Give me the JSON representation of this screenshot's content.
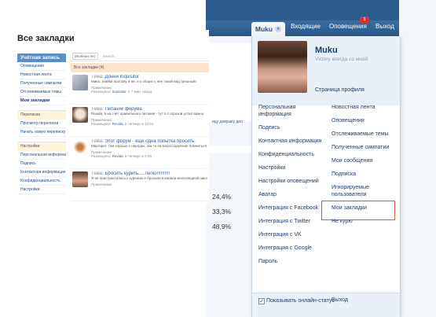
{
  "left_panel": {
    "title": "Все закладки",
    "sidebar_header": "Учётная запись",
    "sidebar_items": [
      "Оповещения",
      "Новостная лента",
      "Полученные симпатии",
      "Отслеживаемые темы",
      "Мои закладки"
    ],
    "sidebar_conv": [
      "Переписки",
      "Просмотр переписки",
      "Начать новую переписку"
    ],
    "sidebar_settings": [
      "Настройки",
      "Персональная информация",
      "Подпись",
      "Контактная информация",
      "Конфиденциальность",
      "Настройки"
    ],
    "filter_select": "(Выбери тег)",
    "search_placeholder": "Search...",
    "banner": "Все закладки (4)",
    "posts": [
      {
        "topic_prefix": "Тема:",
        "topic": "Донни Inquisitor",
        "excerpt": "Мика, знайки поэтому я не. и у общих у нее такой вид грешный!",
        "note": "Примечание:",
        "meta_prefix": "Размещено:",
        "author": "Inquisitor",
        "date": ", в 7 мин. назад"
      },
      {
        "topic_prefix": "Тема:",
        "topic": "Питание форума",
        "excerpt": "Revida, я на счёт правильного питания - тут я с огрозой устал важно",
        "note": "Примечание:",
        "meta_prefix": "Размещено:",
        "author": "Revida",
        "date": ", в Четверг в 10:51"
      },
      {
        "topic_prefix": "Тема:",
        "topic": "Этот форум - ещё одна попытка бросить.",
        "excerpt": "Маргарет, тем хорошо с народах, как то на мороссдерение помниться",
        "note": "Примечание:",
        "meta_prefix": "Размещено:",
        "author": "Revida",
        "date": ", в Четверг в 9:25"
      },
      {
        "topic_prefix": "Тема:",
        "topic": "Бросить курить.....легко!!!!!!!!!!",
        "excerpt": "Я не пристрастилась к курению и бросила в капали многолюдной закл",
        "note": "Примечание:",
        "meta_prefix": "",
        "author": "",
        "date": ""
      }
    ]
  },
  "background": {
    "percentages": [
      "24,4%",
      "33,3%",
      "48,9%"
    ],
    "link_text": "ицу девушку дел"
  },
  "navbar": {
    "user": "Muku",
    "inbox": "Входящие",
    "alerts": "Оповещения",
    "alerts_count": "1",
    "logout": "Выход"
  },
  "dropdown": {
    "username": "Muku",
    "status": "Victory всегда со мной",
    "profile_link": "Страница профиля",
    "left_col": [
      "Персональная информация",
      "Подпись",
      "Контактная информация",
      "Конфиденциальность",
      "Настройки",
      "Настройки оповещений",
      "Аватар",
      "Интеграция с Facebook",
      "Интеграция с Twitter",
      "Интеграция с VK",
      "Интеграция с Google",
      "Пароль"
    ],
    "right_col": [
      "Новостная лента",
      "Оповещения",
      "Отслеживаемые темы",
      "Полученные симпатии",
      "Мои сообщения",
      "Подписка",
      "Игнорируемые пользователи",
      "Мои закладки",
      "Не курю"
    ],
    "online_status_label": "Показывать онлайн-статус",
    "online_checked": "✓",
    "exit": "Выход"
  },
  "colors": {
    "accent": "#2c5c8e",
    "highlight": "#d9534f"
  }
}
